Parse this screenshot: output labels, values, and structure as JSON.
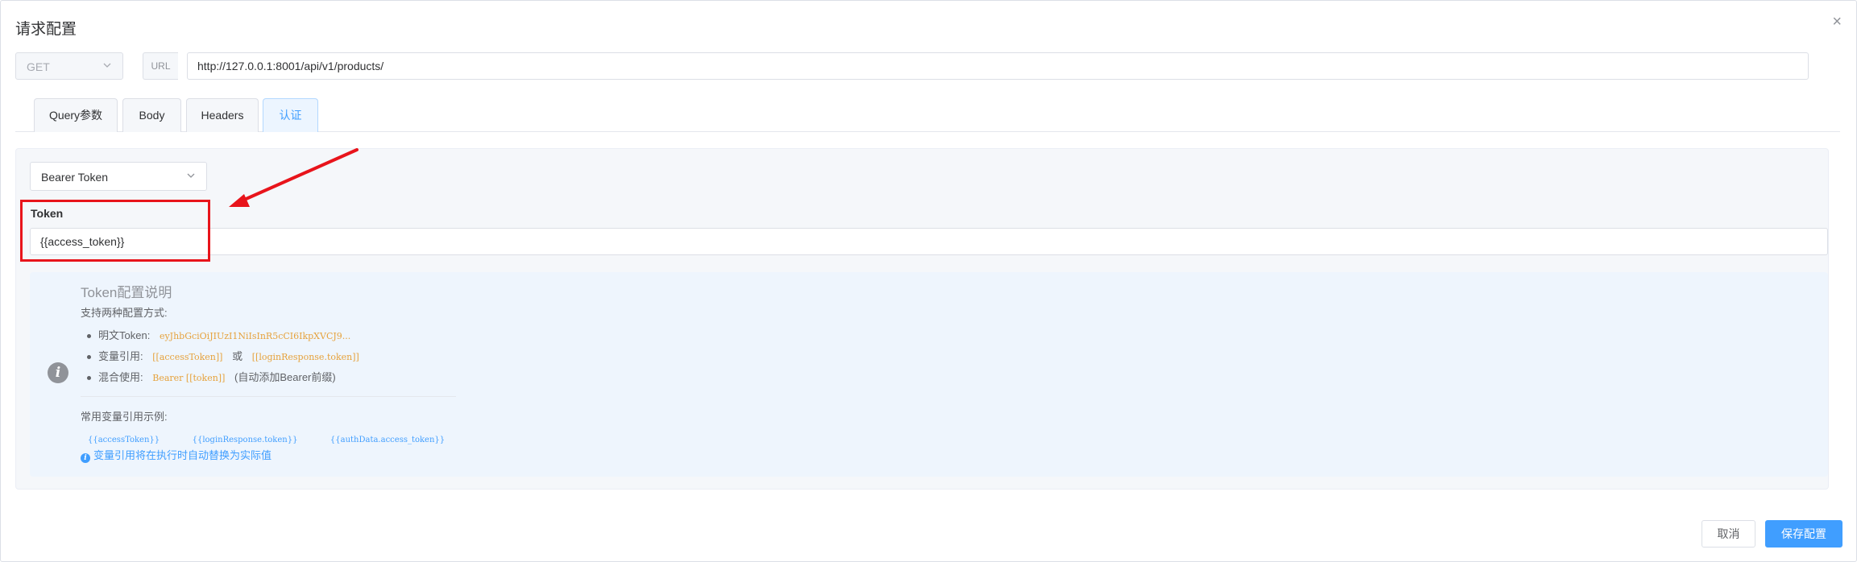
{
  "dialog": {
    "title": "请求配置",
    "close_glyph": "×"
  },
  "request": {
    "method": "GET",
    "url_prefix": "URL",
    "url": "http://127.0.0.1:8001/api/v1/products/"
  },
  "tabs": [
    {
      "label": "Query参数",
      "active": false
    },
    {
      "label": "Body",
      "active": false
    },
    {
      "label": "Headers",
      "active": false
    },
    {
      "label": "认证",
      "active": true
    }
  ],
  "auth": {
    "type": "Bearer Token",
    "token_label": "Token",
    "token_value": "{{access_token}}"
  },
  "info": {
    "icon": "info-icon",
    "title": "Token配置说明",
    "subtitle": "支持两种配置方式:",
    "items": [
      {
        "label": "明文Token:",
        "code": "eyJhbGciOiJIUzI1NiIsInR5cCI6IkpXVCJ9...",
        "sep": "",
        "code2": "",
        "suffix": ""
      },
      {
        "label": "变量引用:",
        "code": "[[accessToken]]",
        "sep": "或",
        "code2": "[[loginResponse.token]]",
        "suffix": ""
      },
      {
        "label": "混合使用:",
        "code": "Bearer [[token]]",
        "sep": "",
        "code2": "",
        "suffix": "(自动添加Bearer前缀)"
      }
    ],
    "common_title": "常用变量引用示例:",
    "common_examples": [
      "{{accessToken}}",
      "{{loginResponse.token}}",
      "{{authData.access_token}}"
    ],
    "note": "变量引用将在执行时自动替换为实际值"
  },
  "footer": {
    "cancel": "取消",
    "save": "保存配置"
  },
  "annotation": {
    "highlight_color": "#e8141b",
    "arrow_color": "#e8141b"
  }
}
